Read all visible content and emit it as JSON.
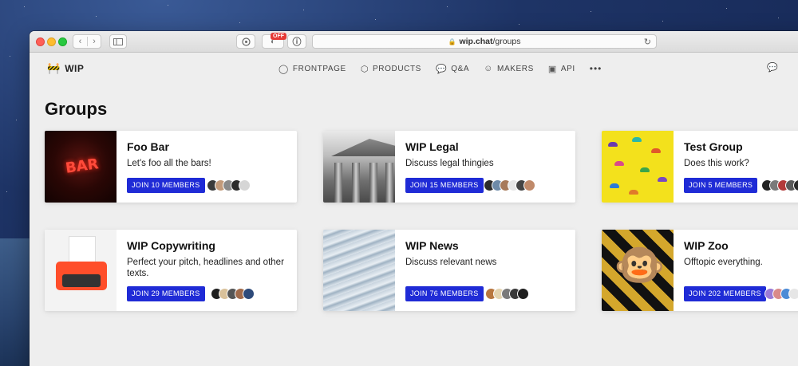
{
  "browser": {
    "url_host": "wip.chat",
    "url_path": "/groups",
    "extension_badge": "OFF"
  },
  "nav": {
    "brand": "WIP",
    "links": [
      {
        "label": "FRONTPAGE",
        "icon": "check-circle-icon"
      },
      {
        "label": "PRODUCTS",
        "icon": "boxes-icon"
      },
      {
        "label": "Q&A",
        "icon": "speech-bubbles-icon"
      },
      {
        "label": "MAKERS",
        "icon": "smiley-icon"
      },
      {
        "label": "API",
        "icon": "cube-icon"
      }
    ],
    "more": "•••"
  },
  "page": {
    "title": "Groups"
  },
  "groups": [
    {
      "name": "Foo Bar",
      "description": "Let's foo all the bars!",
      "join_label": "JOIN 10 MEMBERS",
      "thumb_text": "BAR",
      "avatars": [
        "#3b3b3b",
        "#c29a7a",
        "#8a8a8a",
        "#2b2b2b",
        "#d6d6d6"
      ]
    },
    {
      "name": "WIP Legal",
      "description": "Discuss legal thingies",
      "join_label": "JOIN 15 MEMBERS",
      "avatars": [
        "#2c2c2c",
        "#6d8aa8",
        "#a77a5a",
        "#e6e6e6",
        "#444444",
        "#c08a6a"
      ]
    },
    {
      "name": "Test Group",
      "description": "Does this work?",
      "join_label": "JOIN 5 MEMBERS",
      "avatars": [
        "#222222",
        "#7a7a7a",
        "#b33a3a",
        "#5a5a5a",
        "#2a2a2a"
      ]
    },
    {
      "name": "WIP Copywriting",
      "description": "Perfect your pitch, headlines and other texts.",
      "join_label": "JOIN 29 MEMBERS",
      "avatars": [
        "#1f1f1f",
        "#d9c19a",
        "#555555",
        "#a06a4a",
        "#2d4a7a"
      ]
    },
    {
      "name": "WIP News",
      "description": "Discuss relevant news",
      "join_label": "JOIN 76 MEMBERS",
      "avatars": [
        "#b8773f",
        "#e3d3b0",
        "#7a7a7a",
        "#3a3a3a",
        "#1f1f1f"
      ]
    },
    {
      "name": "WIP Zoo",
      "description": "Offtopic everything.",
      "join_label": "JOIN 202 MEMBERS",
      "avatars": [
        "#9a7ad6",
        "#d98a8a",
        "#4a8ad6",
        "#e6e6e6"
      ]
    }
  ],
  "colors": {
    "join_button": "#1f2bd6"
  }
}
